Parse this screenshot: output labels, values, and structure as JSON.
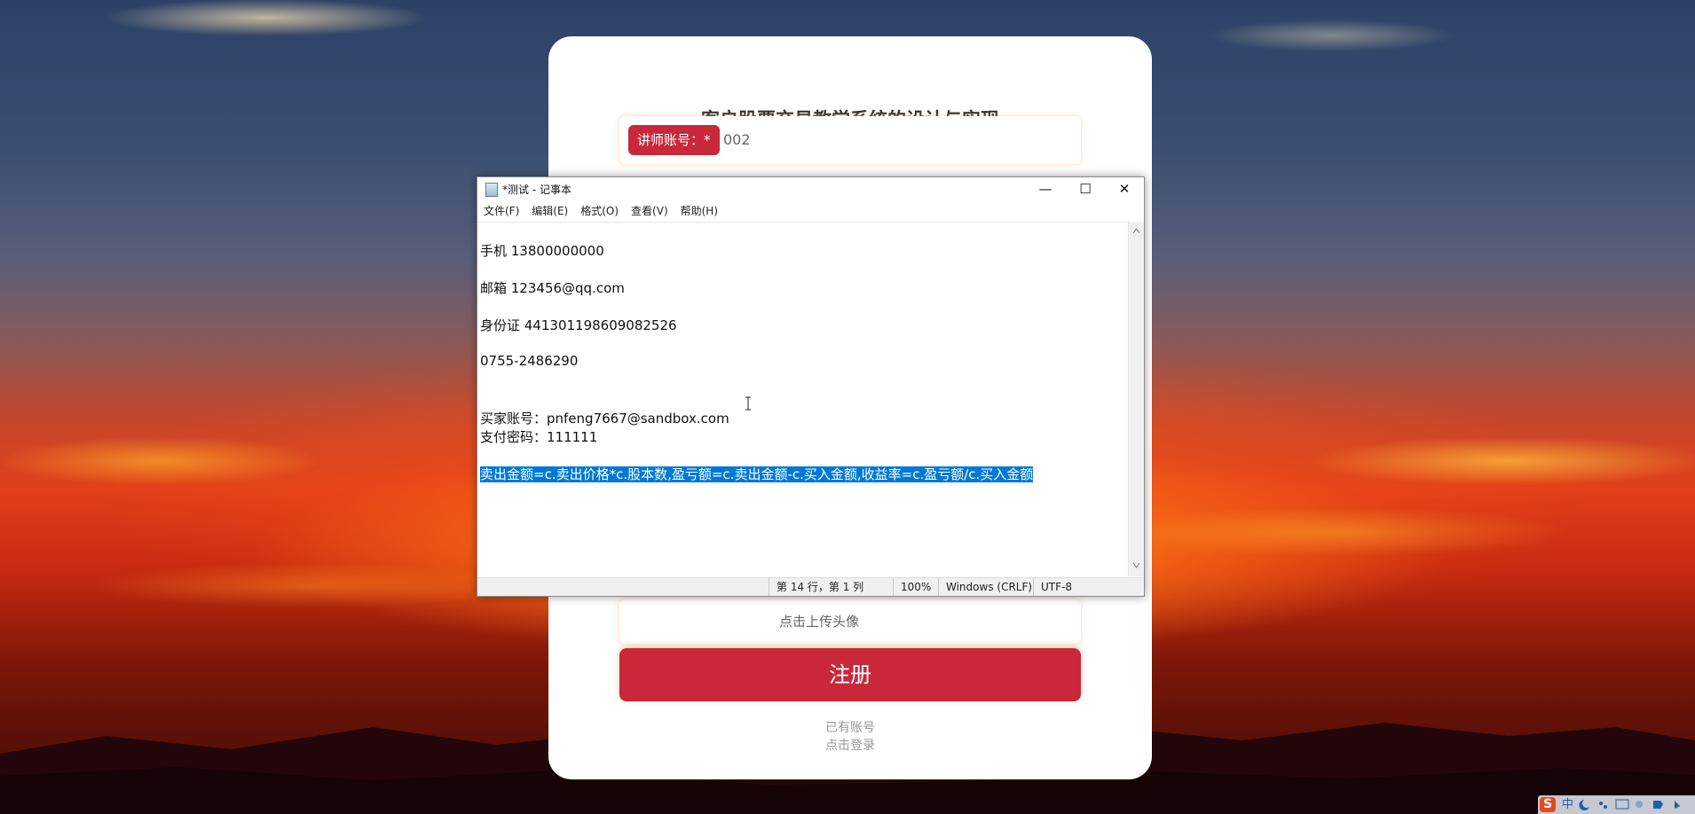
{
  "background": {
    "description_colors": [
      "#2d4266",
      "#e2401a",
      "#3a0a06"
    ]
  },
  "register_form": {
    "title": "客户股票交易教学系统的设计与实现",
    "instructor_label": "讲师账号：",
    "required_mark": "*",
    "instructor_value": "002",
    "upload_avatar": "点击上传头像",
    "register_button": "注册",
    "have_account": "已有账号",
    "click_login": "点击登录",
    "accent_color": "#c8283a"
  },
  "notepad": {
    "title": "*测试 - 记事本",
    "menu": [
      "文件(F)",
      "编辑(E)",
      "格式(O)",
      "查看(V)",
      "帮助(H)"
    ],
    "lines": {
      "phone": "手机 13800000000",
      "email": "邮箱 123456@qq.com",
      "id_card": "身份证 441301198609082526",
      "tel": "0755-2486290",
      "buyer": "买家账号：pnfeng7667@sandbox.com",
      "pay_pwd": "支付密码：111111",
      "formula": "卖出金额=c.卖出价格*c.股本数,盈亏额=c.卖出金额-c.买入金额,收益率=c.盈亏额/c.买入金额"
    },
    "status": {
      "position": "第 14 行，第 1 列",
      "zoom": "100%",
      "line_ending": "Windows (CRLF)",
      "encoding": "UTF-8"
    },
    "window_buttons": {
      "minimize": "—",
      "maximize": "☐",
      "close": "✕"
    }
  },
  "tray": {
    "ime_logo": "S",
    "ime_mode": "中"
  }
}
